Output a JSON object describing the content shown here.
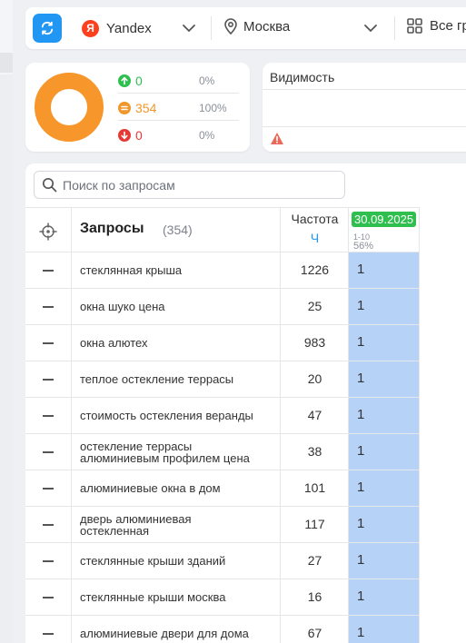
{
  "toolbar": {
    "engine": {
      "logo_letter": "Я",
      "label": "Yandex",
      "logo_color": "#fc3f1d"
    },
    "region": {
      "label": "Москва"
    },
    "groups": {
      "label": "Все гр"
    },
    "accent": "#2196f3"
  },
  "stats": {
    "up": {
      "count": "0",
      "percent": "0%",
      "color": "#2fbf4f"
    },
    "same": {
      "count": "354",
      "percent": "100%",
      "color": "#f0962a"
    },
    "down": {
      "count": "0",
      "percent": "0%",
      "color": "#e53935"
    },
    "donut_color": "#f7962a"
  },
  "visibility": {
    "title": "Видимость"
  },
  "search": {
    "placeholder": "Поиск по запросам"
  },
  "table": {
    "header": {
      "queries_label": "Запросы",
      "queries_count": "(354)",
      "frequency_label": "Частота",
      "frequency_unit": "Ч",
      "date": "30.09.2025",
      "range": "1-10",
      "percent": "56%"
    },
    "rows": [
      {
        "query": "стеклянная крыша",
        "frequency": "1226",
        "position": "1"
      },
      {
        "query": "окна шуко цена",
        "frequency": "25",
        "position": "1"
      },
      {
        "query": "окна алютех",
        "frequency": "983",
        "position": "1"
      },
      {
        "query": "теплое остекление террасы",
        "frequency": "20",
        "position": "1"
      },
      {
        "query": "стоимость остекления веранды",
        "frequency": "47",
        "position": "1"
      },
      {
        "query": "остекление террасы алюминиевым профилем цена",
        "frequency": "38",
        "position": "1"
      },
      {
        "query": "алюминиевые окна в дом",
        "frequency": "101",
        "position": "1"
      },
      {
        "query": "дверь алюминиевая остекленная",
        "frequency": "117",
        "position": "1"
      },
      {
        "query": "стеклянные крыши зданий",
        "frequency": "27",
        "position": "1"
      },
      {
        "query": "стеклянные крыши москва",
        "frequency": "16",
        "position": "1"
      },
      {
        "query": "алюминиевые двери для дома",
        "frequency": "67",
        "position": "1"
      }
    ]
  }
}
